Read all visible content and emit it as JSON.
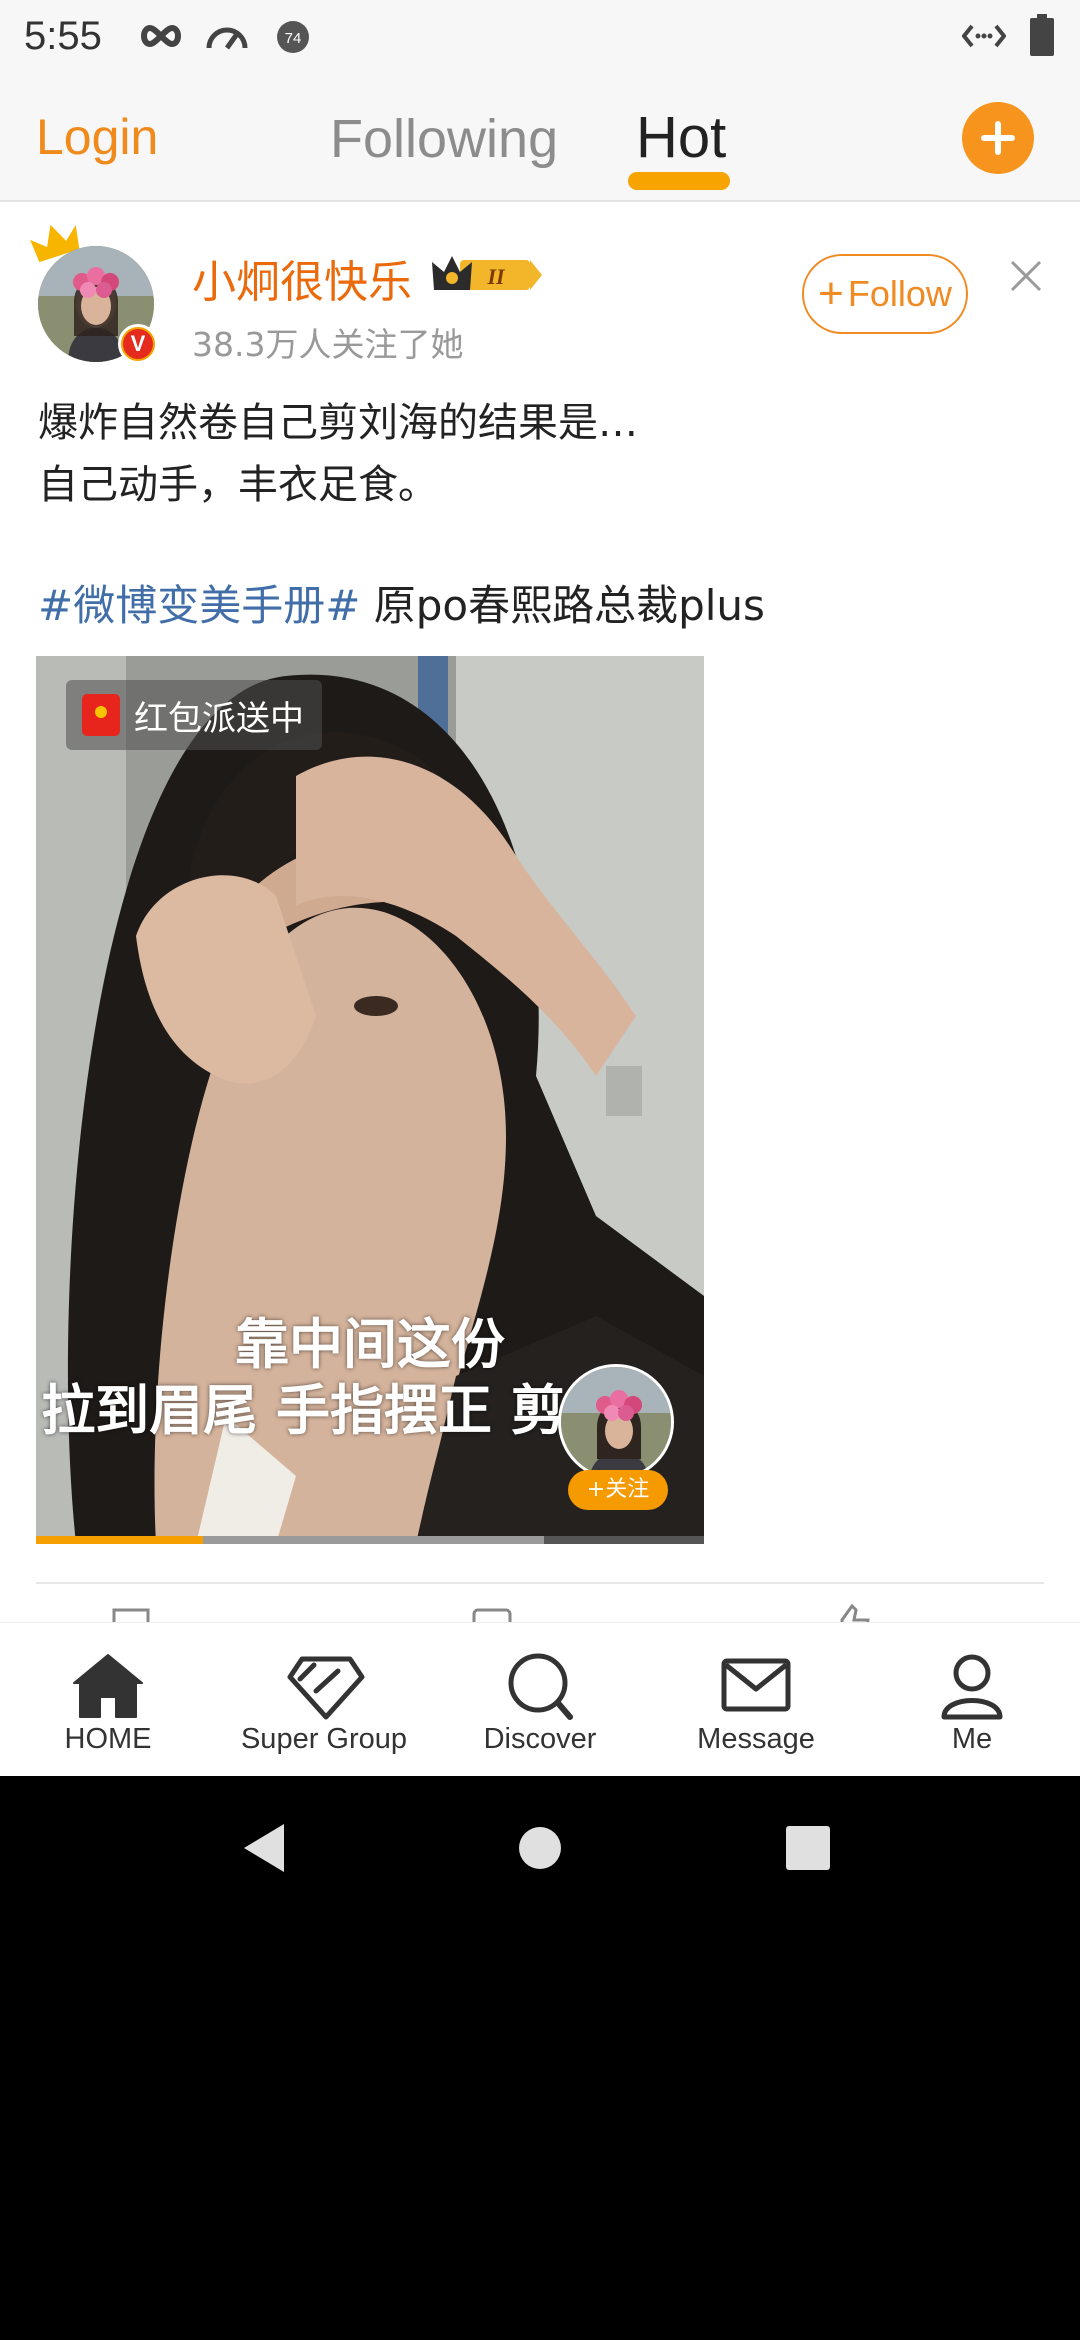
{
  "status_bar": {
    "time": "5:55",
    "icons": [
      "infinity-icon",
      "speedometer-icon",
      "notification-count-icon",
      "code-arrows-icon",
      "battery-icon"
    ],
    "notification_badge": "74"
  },
  "top_nav": {
    "login": "Login",
    "following": "Following",
    "hot": "Hot",
    "active_tab": "Hot"
  },
  "post": {
    "username": "小炯很快乐",
    "vip_level": "II",
    "followers": "38.3万人关注了她",
    "follow_label": "Follow",
    "text_lines": [
      "爆炸自然卷自己剪刘海的结果是…",
      "自己动手，丰衣足食。"
    ],
    "hashtag": "#微博变美手册#",
    "text_suffix": " 原po春熙路总裁plus",
    "video": {
      "red_packet": "红包派送中",
      "subtitle_line1": "靠中间这份",
      "subtitle_line2": "拉到眉尾 手指摆正 剪掉",
      "mini_follow": "+关注",
      "progress": 0.25
    }
  },
  "tabs": [
    {
      "label": "HOME",
      "icon": "home-icon"
    },
    {
      "label": "Super Group",
      "icon": "diamond-icon"
    },
    {
      "label": "Discover",
      "icon": "search-icon"
    },
    {
      "label": "Message",
      "icon": "mail-icon"
    },
    {
      "label": "Me",
      "icon": "person-icon"
    }
  ],
  "colors": {
    "accent": "#f08a1a",
    "hashtag": "#416ea8",
    "username": "#ea6a0c"
  }
}
